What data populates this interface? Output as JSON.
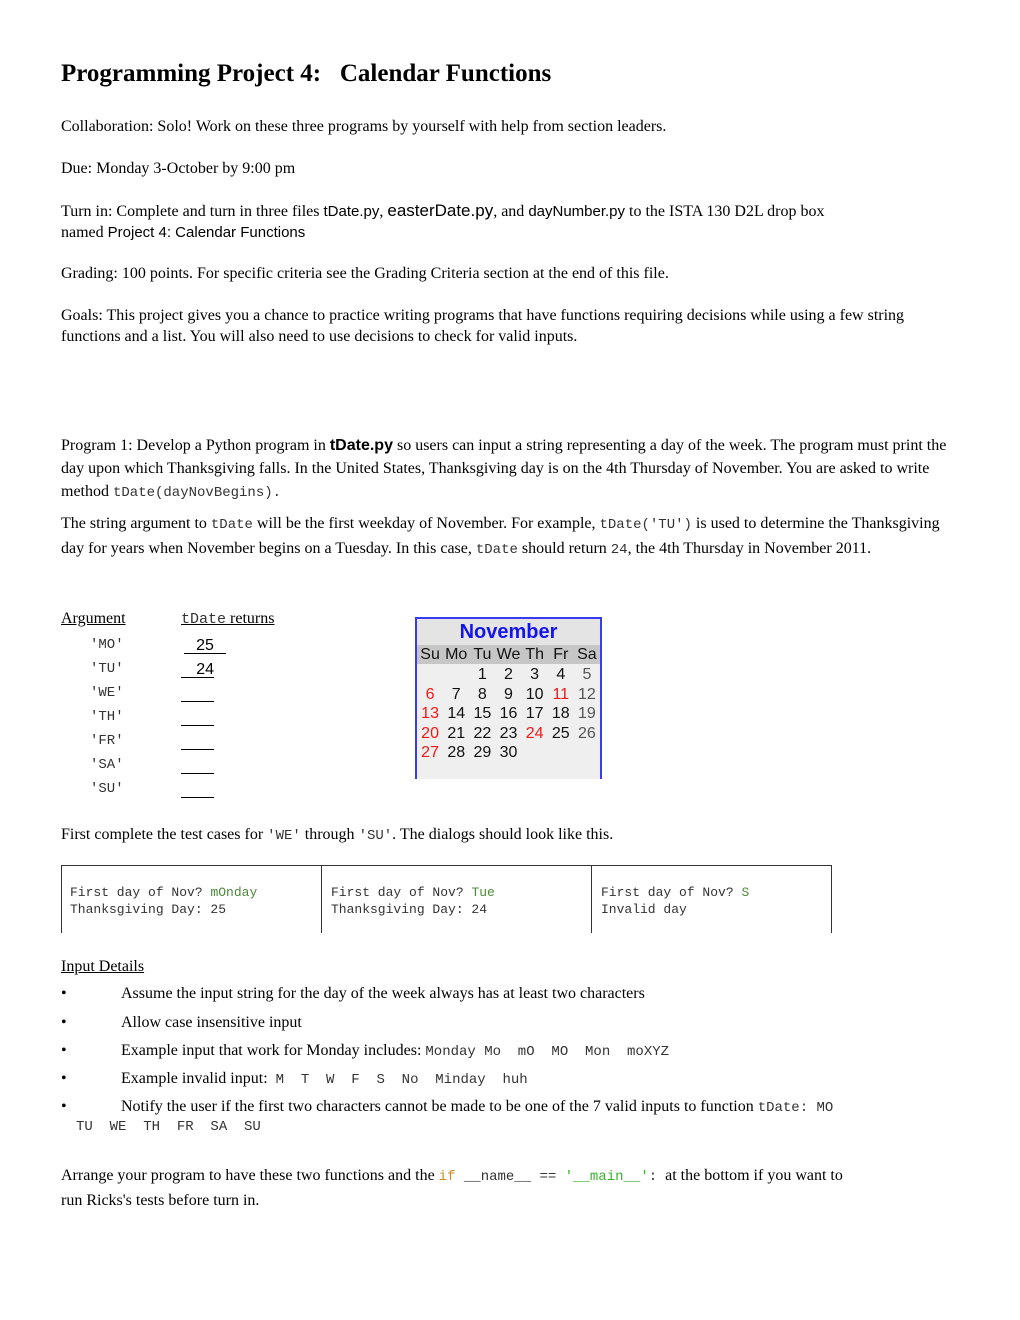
{
  "title": "Programming Project 4:   Calendar Functions",
  "collaboration": "Collaboration: Solo! Work on these three programs by yourself with help from section leaders.",
  "due": "Due: Monday 3-October by 9:00 pm",
  "turn_in": {
    "prefix": "Turn in: Complete and turn in three files ",
    "file1": "tDate.py",
    "sep1": ", ",
    "file2": "easterDate.py",
    "sep2": ", and ",
    "file3": "dayNumber.py",
    "suffix": " to the ISTA 130 D2L drop box",
    "named_prefix": "named ",
    "dropbox_name": "Project 4: Calendar Functions"
  },
  "grading": "Grading: 100 points. For specific criteria see the Grading Criteria section at the end of this file.",
  "goals": "Goals: This project gives you a chance to practice writing programs that have functions requiring decisions while using a few string functions and a list. You will also need to use decisions to check for valid inputs.",
  "program1": {
    "p1_a": "Program 1: Develop a Python program in ",
    "p1_file": "tDate.py",
    "p1_b": " so users can input a string representing a day of the week. The program must print the day upon which Thanksgiving falls. In the United States, Thanksgiving day is on the 4th Thursday of November. You are asked to write method ",
    "p1_code": "tDate(dayNovBegins).",
    "p2_a": "The string argument to ",
    "p2_code1": "tDate",
    "p2_b": " will be the first weekday of November. For example, ",
    "p2_code2": "tDate('TU')",
    "p2_c": " is used to determine the Thanksgiving day for years when November begins on a Tuesday. In this case, ",
    "p2_code3": "tDate",
    "p2_d": " should return ",
    "p2_code4": "24",
    "p2_e": ", the 4th Thursday in November 2011."
  },
  "arg_table": {
    "header_arg": "Argument",
    "header_ret_code": "tDate",
    "header_ret": " returns",
    "rows": [
      {
        "arg": "'MO'",
        "ret": "25"
      },
      {
        "arg": "'TU'",
        "ret": "24"
      },
      {
        "arg": "'WE'",
        "ret": ""
      },
      {
        "arg": "'TH'",
        "ret": ""
      },
      {
        "arg": "'FR'",
        "ret": ""
      },
      {
        "arg": "'SA'",
        "ret": ""
      },
      {
        "arg": "'SU'",
        "ret": ""
      }
    ]
  },
  "calendar": {
    "month": "November",
    "weekdays": [
      "Su",
      "Mo",
      "Tu",
      "We",
      "Th",
      "Fr",
      "Sa"
    ],
    "weeks": [
      [
        "",
        "",
        "1",
        "2",
        "3",
        "4",
        "5"
      ],
      [
        "6",
        "7",
        "8",
        "9",
        "10",
        "11",
        "12"
      ],
      [
        "13",
        "14",
        "15",
        "16",
        "17",
        "18",
        "19"
      ],
      [
        "20",
        "21",
        "22",
        "23",
        "24",
        "25",
        "26"
      ],
      [
        "27",
        "28",
        "29",
        "30",
        "",
        "",
        ""
      ]
    ],
    "highlight_red": [
      "6",
      "11",
      "13",
      "20",
      "24",
      "27"
    ],
    "colors": {
      "title": "#1414f0",
      "border": "#3a3af0",
      "red": "#f01818"
    }
  },
  "test_intro": {
    "a": "First complete the test cases for ",
    "c1": "'WE'",
    "b": " through ",
    "c2": "'SU'",
    "c": ".  The dialogs should look like this."
  },
  "dialogs": [
    {
      "prompt": "First day of Nov? ",
      "input": "mOnday",
      "output": "Thanksgiving Day: 25"
    },
    {
      "prompt": "First day of Nov? ",
      "input": "Tue",
      "output": "Thanksgiving Day: 24"
    },
    {
      "prompt": "First day of Nov? ",
      "input": "S",
      "output": "Invalid day"
    }
  ],
  "input_details": {
    "heading": "Input Details",
    "bullet": "•",
    "items": [
      {
        "text": "Assume the input string for the day of the week always has at least two characters"
      },
      {
        "text": "Allow case insensitive input"
      },
      {
        "text": "Example input that work for Monday includes: ",
        "code": "Monday Mo  mO  MO  Mon  moXYZ"
      },
      {
        "text": "Example invalid input:  ",
        "code": "M  T  W  F  S  No  Minday  huh"
      },
      {
        "text": "Notify the user if the first two characters cannot be made to be one of the 7 valid inputs to function ",
        "code": "tDate: MO",
        "code2": "TU  WE  TH  FR  SA  SU"
      }
    ]
  },
  "arrange": {
    "a": "Arrange your program to have these two functions and the ",
    "kw_if": "if",
    "name": " __name__ == ",
    "main": "'__main__'",
    "colon": ":",
    "b": "  at the bottom if you want to",
    "line2": "run Ricks's tests before turn in."
  }
}
